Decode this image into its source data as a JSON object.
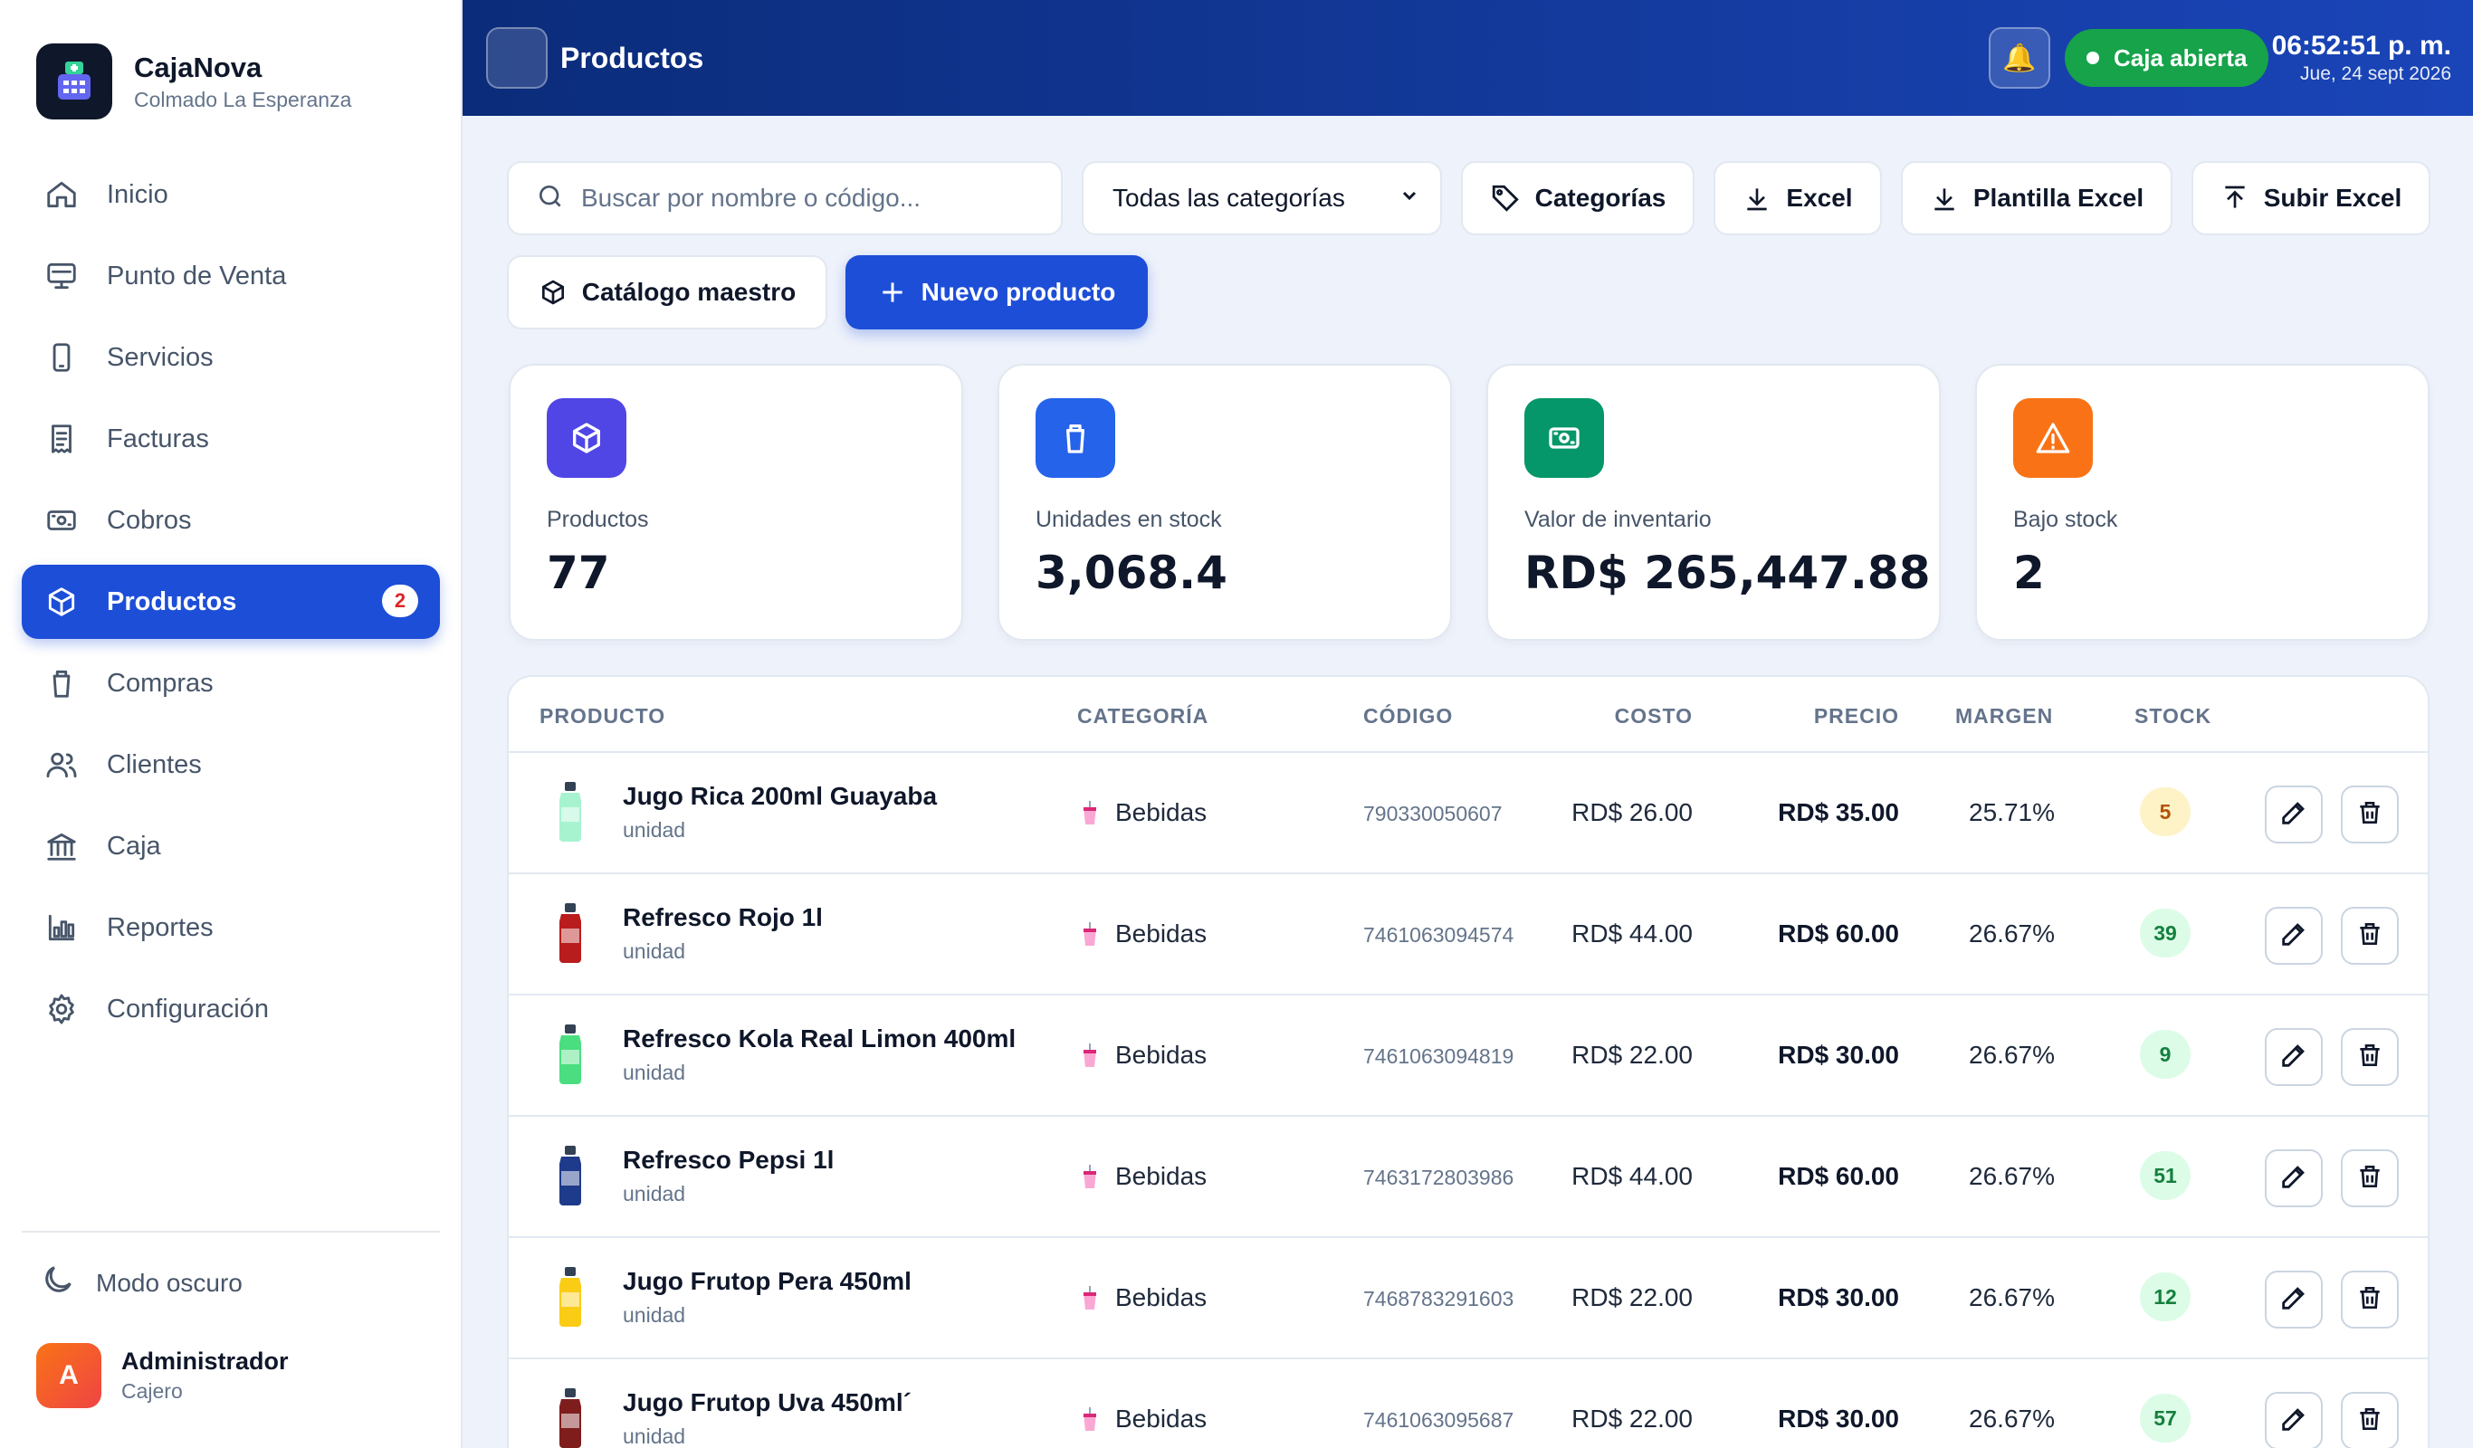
{
  "brand": {
    "name": "CajaNova",
    "subtitle": "Colmado La Esperanza"
  },
  "nav": [
    {
      "label": "Inicio",
      "icon": "home-icon"
    },
    {
      "label": "Punto de Venta",
      "icon": "monitor-icon"
    },
    {
      "label": "Servicios",
      "icon": "phone-icon"
    },
    {
      "label": "Facturas",
      "icon": "receipt-icon"
    },
    {
      "label": "Cobros",
      "icon": "cash-icon"
    },
    {
      "label": "Productos",
      "icon": "box-icon",
      "active": true,
      "badge": "2"
    },
    {
      "label": "Compras",
      "icon": "bag-icon"
    },
    {
      "label": "Clientes",
      "icon": "users-icon"
    },
    {
      "label": "Caja",
      "icon": "bank-icon"
    },
    {
      "label": "Reportes",
      "icon": "chart-icon"
    },
    {
      "label": "Configuración",
      "icon": "gear-icon"
    }
  ],
  "dark_mode_label": "Modo oscuro",
  "user": {
    "initial": "A",
    "name": "Administrador",
    "role": "Cajero"
  },
  "header": {
    "title": "Productos",
    "status": "Caja abierta",
    "time": "06:52:51 p. m.",
    "date": "Jue, 24 sept 2026"
  },
  "toolbar": {
    "search_placeholder": "Buscar por nombre o código...",
    "category_select": "Todas las categorías",
    "categories_btn": "Categorías",
    "excel_btn": "Excel",
    "template_btn": "Plantilla Excel",
    "upload_btn": "Subir Excel",
    "catalog_btn": "Catálogo maestro",
    "new_btn": "Nuevo producto"
  },
  "stats": [
    {
      "label": "Productos",
      "value": "77",
      "color": "#4f46e5",
      "icon": "box-icon"
    },
    {
      "label": "Unidades en stock",
      "value": "3,068.4",
      "color": "#2563eb",
      "icon": "bag-icon"
    },
    {
      "label": "Valor de inventario",
      "value": "RD$ 265,447.88",
      "color": "#059669",
      "icon": "cash-icon"
    },
    {
      "label": "Bajo stock",
      "value": "2",
      "color": "#f97316",
      "icon": "warning-icon"
    }
  ],
  "table": {
    "headers": {
      "product": "PRODUCTO",
      "category": "CATEGORÍA",
      "code": "CÓDIGO",
      "cost": "COSTO",
      "price": "PRECIO",
      "margin": "MARGEN",
      "stock": "STOCK"
    },
    "rows": [
      {
        "name": "Jugo Rica 200ml Guayaba",
        "unit": "unidad",
        "category": "Bebidas",
        "code": "790330050607",
        "cost": "RD$ 26.00",
        "price": "RD$ 35.00",
        "margin": "25.71%",
        "stock": "5",
        "low": true,
        "thumb": "#a7f3d0"
      },
      {
        "name": "Refresco Rojo 1l",
        "unit": "unidad",
        "category": "Bebidas",
        "code": "7461063094574",
        "cost": "RD$ 44.00",
        "price": "RD$ 60.00",
        "margin": "26.67%",
        "stock": "39",
        "low": false,
        "thumb": "#b91c1c"
      },
      {
        "name": "Refresco Kola Real Limon 400ml",
        "unit": "unidad",
        "category": "Bebidas",
        "code": "7461063094819",
        "cost": "RD$ 22.00",
        "price": "RD$ 30.00",
        "margin": "26.67%",
        "stock": "9",
        "low": false,
        "thumb": "#4ade80"
      },
      {
        "name": "Refresco Pepsi 1l",
        "unit": "unidad",
        "category": "Bebidas",
        "code": "7463172803986",
        "cost": "RD$ 44.00",
        "price": "RD$ 60.00",
        "margin": "26.67%",
        "stock": "51",
        "low": false,
        "thumb": "#1e3a8a"
      },
      {
        "name": "Jugo Frutop Pera 450ml",
        "unit": "unidad",
        "category": "Bebidas",
        "code": "7468783291603",
        "cost": "RD$ 22.00",
        "price": "RD$ 30.00",
        "margin": "26.67%",
        "stock": "12",
        "low": false,
        "thumb": "#facc15"
      },
      {
        "name": "Jugo Frutop Uva 450ml´",
        "unit": "unidad",
        "category": "Bebidas",
        "code": "7461063095687",
        "cost": "RD$ 22.00",
        "price": "RD$ 30.00",
        "margin": "26.67%",
        "stock": "57",
        "low": false,
        "thumb": "#7f1d1d"
      }
    ]
  }
}
